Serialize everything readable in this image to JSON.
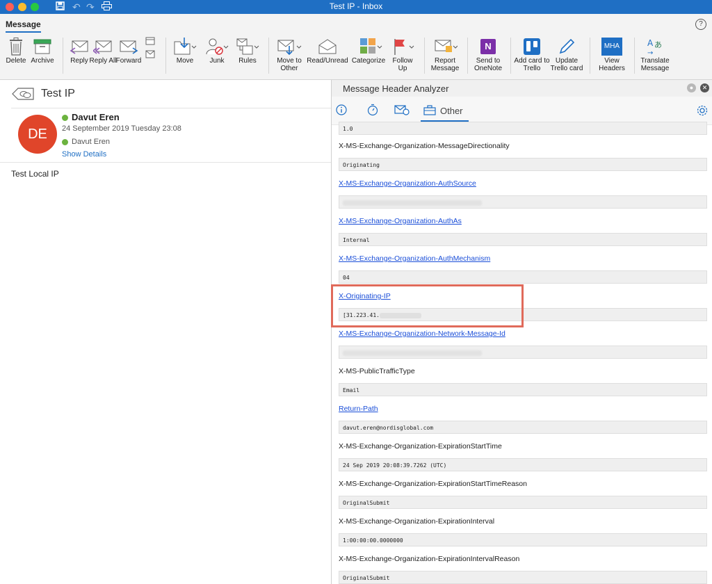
{
  "window": {
    "title": "Test IP - Inbox"
  },
  "ribbon": {
    "tab": "Message",
    "buttons": [
      {
        "id": "delete",
        "label": "Delete"
      },
      {
        "id": "archive",
        "label": "Archive"
      },
      {
        "id": "reply",
        "label": "Reply"
      },
      {
        "id": "reply_all",
        "label": "Reply All"
      },
      {
        "id": "forward",
        "label": "Forward"
      },
      {
        "id": "move",
        "label": "Move"
      },
      {
        "id": "junk",
        "label": "Junk"
      },
      {
        "id": "rules",
        "label": "Rules"
      },
      {
        "id": "move_to_other",
        "label": "Move to Other"
      },
      {
        "id": "read_unread",
        "label": "Read/Unread"
      },
      {
        "id": "categorize",
        "label": "Categorize"
      },
      {
        "id": "follow_up",
        "label": "Follow Up"
      },
      {
        "id": "report_message",
        "label": "Report Message"
      },
      {
        "id": "send_onenote",
        "label": "Send to OneNote"
      },
      {
        "id": "add_trello",
        "label": "Add card to Trello"
      },
      {
        "id": "update_trello",
        "label": "Update Trello card"
      },
      {
        "id": "view_headers",
        "label": "View Headers"
      },
      {
        "id": "translate",
        "label": "Translate Message"
      }
    ],
    "mha_badge": "MHA",
    "onenote_letter": "N"
  },
  "message": {
    "subject": "Test IP",
    "avatar_initials": "DE",
    "avatar_color": "#e0452a",
    "sender": "Davut Eren",
    "date": "24 September 2019 Tuesday 23:08",
    "to": "Davut Eren",
    "show_details": "Show Details",
    "body": "Test Local IP"
  },
  "mha": {
    "title": "Message Header Analyzer",
    "active_tab": "Other",
    "headers": [
      {
        "name": "",
        "value": "1.0",
        "link": false
      },
      {
        "name": "X-MS-Exchange-Organization-MessageDirectionality",
        "value": "Originating",
        "link": false
      },
      {
        "name": "X-MS-Exchange-Organization-AuthSource",
        "value": "",
        "link": true,
        "redacted": true
      },
      {
        "name": "X-MS-Exchange-Organization-AuthAs",
        "value": "Internal",
        "link": true
      },
      {
        "name": "X-MS-Exchange-Organization-AuthMechanism",
        "value": "04",
        "link": true
      },
      {
        "name": "X-Originating-IP",
        "value": "[31.223.41.",
        "link": true,
        "partial": true
      },
      {
        "name": "X-MS-Exchange-Organization-Network-Message-Id",
        "value": "",
        "link": true,
        "redacted": true
      },
      {
        "name": "X-MS-PublicTrafficType",
        "value": "Email",
        "link": false
      },
      {
        "name": "Return-Path",
        "value": "davut.eren@nordisglobal.com",
        "link": true
      },
      {
        "name": "X-MS-Exchange-Organization-ExpirationStartTime",
        "value": "24 Sep 2019 20:08:39.7262 (UTC)",
        "link": false
      },
      {
        "name": "X-MS-Exchange-Organization-ExpirationStartTimeReason",
        "value": "OriginalSubmit",
        "link": false
      },
      {
        "name": "X-MS-Exchange-Organization-ExpirationInterval",
        "value": "1:00:00:00.0000000",
        "link": false
      },
      {
        "name": "X-MS-Exchange-Organization-ExpirationIntervalReason",
        "value": "OriginalSubmit",
        "link": false
      }
    ]
  }
}
